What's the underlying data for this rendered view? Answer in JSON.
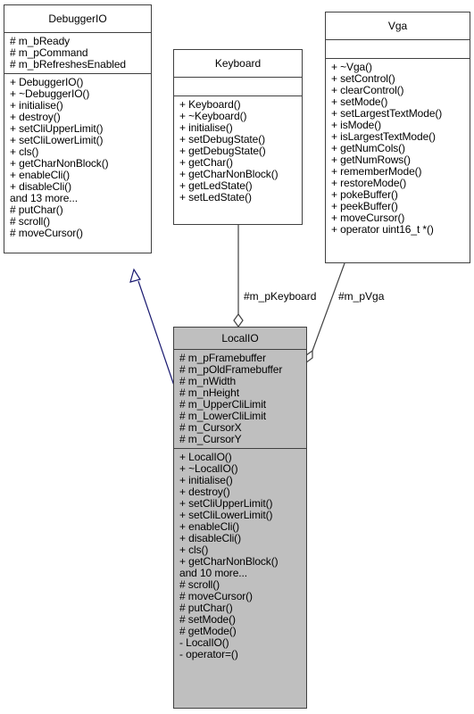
{
  "classes": {
    "debuggerio": {
      "name": "DebuggerIO",
      "attributes": [
        "# m_bReady",
        "# m_pCommand",
        "# m_bRefreshesEnabled"
      ],
      "methods": [
        "+ DebuggerIO()",
        "+ ~DebuggerIO()",
        "+ initialise()",
        "+ destroy()",
        "+ setCliUpperLimit()",
        "+ setCliLowerLimit()",
        "+ cls()",
        "+ getCharNonBlock()",
        "+ enableCli()",
        "+ disableCli()",
        "and 13 more...",
        "# putChar()",
        "# scroll()",
        "# moveCursor()"
      ]
    },
    "keyboard": {
      "name": "Keyboard",
      "attributes": [],
      "methods": [
        "+ Keyboard()",
        "+ ~Keyboard()",
        "+ initialise()",
        "+ setDebugState()",
        "+ getDebugState()",
        "+ getChar()",
        "+ getCharNonBlock()",
        "+ getLedState()",
        "+ setLedState()"
      ]
    },
    "vga": {
      "name": "Vga",
      "attributes": [],
      "methods": [
        "+ ~Vga()",
        "+ setControl()",
        "+ clearControl()",
        "+ setMode()",
        "+ setLargestTextMode()",
        "+ isMode()",
        "+ isLargestTextMode()",
        "+ getNumCols()",
        "+ getNumRows()",
        "+ rememberMode()",
        "+ restoreMode()",
        "+ pokeBuffer()",
        "+ peekBuffer()",
        "+ moveCursor()",
        "+ operator uint16_t *()"
      ]
    },
    "localio": {
      "name": "LocalIO",
      "attributes": [
        "# m_pFramebuffer",
        "# m_pOldFramebuffer",
        "# m_nWidth",
        "# m_nHeight",
        "# m_UpperCliLimit",
        "# m_LowerCliLimit",
        "# m_CursorX",
        "# m_CursorY"
      ],
      "methods": [
        "+ LocalIO()",
        "+ ~LocalIO()",
        "+ initialise()",
        "+ destroy()",
        "+ setCliUpperLimit()",
        "+ setCliLowerLimit()",
        "+ enableCli()",
        "+ disableCli()",
        "+ cls()",
        "+ getCharNonBlock()",
        "and 10 more...",
        "# scroll()",
        "# moveCursor()",
        "# putChar()",
        "# setMode()",
        "# getMode()",
        "- LocalIO()",
        "- operator=()"
      ]
    }
  },
  "relations": [
    {
      "type": "inheritance",
      "from": "LocalIO",
      "to": "DebuggerIO",
      "label": ""
    },
    {
      "type": "aggregation",
      "from": "LocalIO",
      "to": "Keyboard",
      "label": "#m_pKeyboard"
    },
    {
      "type": "aggregation",
      "from": "LocalIO",
      "to": "Vga",
      "label": "#m_pVga"
    }
  ],
  "colors": {
    "inheritance_edge": "#191970",
    "aggregation_edge": "#404040",
    "focus_fill": "#bfbfbf",
    "border": "#404040"
  }
}
